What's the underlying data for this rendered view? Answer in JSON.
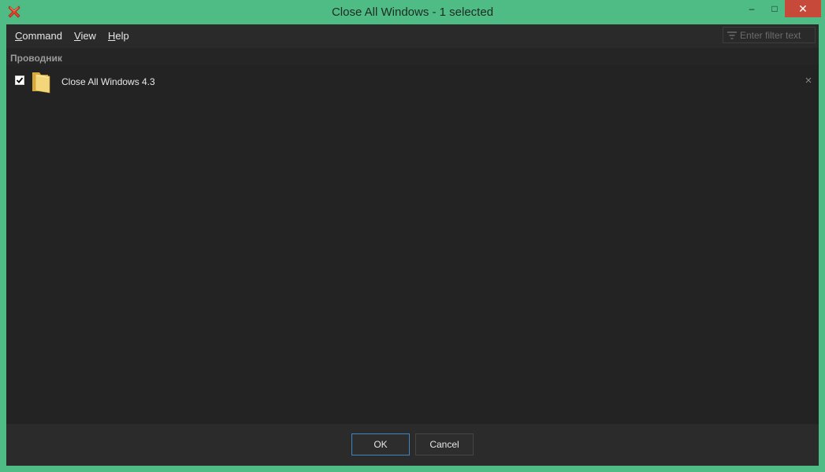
{
  "window": {
    "title": "Close All Windows - 1 selected",
    "controls": {
      "minimize": "–",
      "maximize": "□",
      "close": "✕"
    }
  },
  "menu": {
    "items": [
      {
        "underline": "C",
        "rest": "ommand"
      },
      {
        "underline": "V",
        "rest": "iew"
      },
      {
        "underline": "H",
        "rest": "elp"
      }
    ]
  },
  "filter": {
    "placeholder": "Enter filter text"
  },
  "group": {
    "header": "Проводник",
    "items": [
      {
        "label": "Close All Windows 4.3",
        "checked": true,
        "icon": "folder-icon"
      }
    ]
  },
  "footer": {
    "ok_label": "OK",
    "cancel_label": "Cancel"
  },
  "colors": {
    "frame": "#4fbc85",
    "background": "#252525",
    "ok_border": "#3b87c6",
    "close_button": "#c7493a"
  }
}
